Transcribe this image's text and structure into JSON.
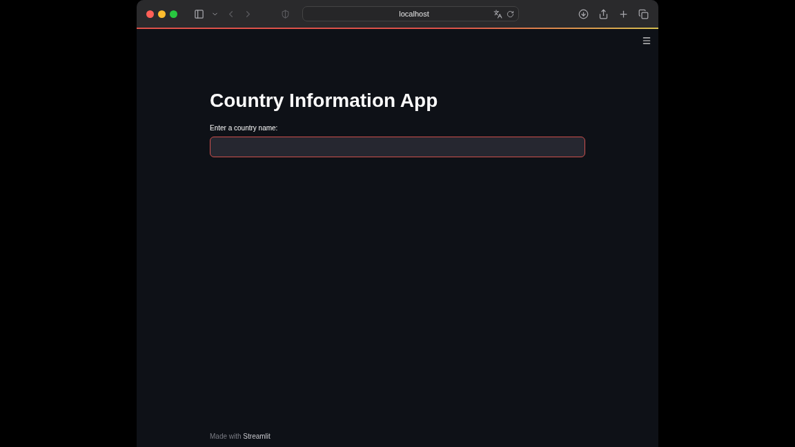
{
  "browser": {
    "address": "localhost"
  },
  "app": {
    "title": "Country Information App",
    "input": {
      "label": "Enter a country name:",
      "focused": true
    }
  },
  "footer": {
    "text": "Made with ",
    "link": "Streamlit"
  }
}
